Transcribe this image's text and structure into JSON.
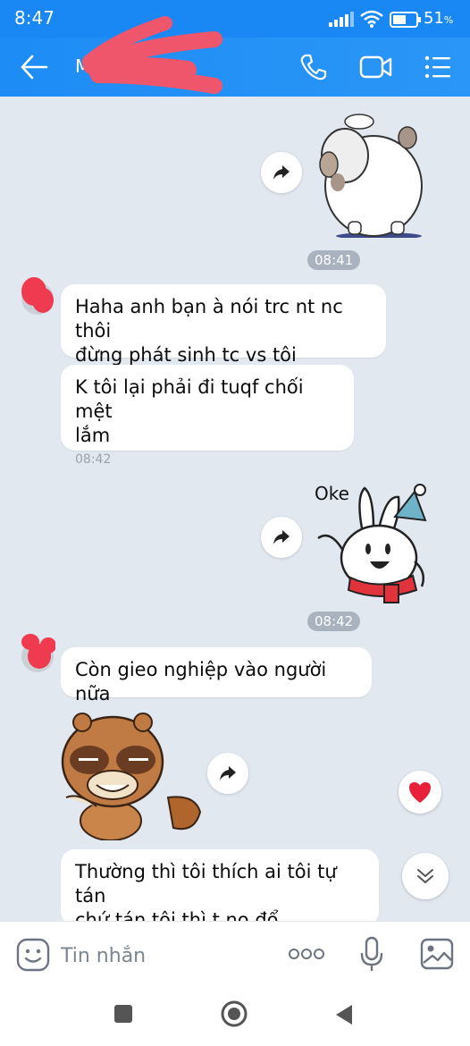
{
  "status": {
    "time": "8:47",
    "battery_value": "51",
    "battery_unit": "%"
  },
  "header": {
    "contact_name_visible": "M                  n"
  },
  "messages": {
    "time1": "08:41",
    "m1_line1": "Haha anh bạn à nói trc nt nc thôi",
    "m1_line2": "đừng phát sinh tc vs tôi",
    "m2_line1": "K tôi lại phải đi tuqf chối mệt",
    "m2_line2": "lắm",
    "m2_time": "08:42",
    "sticker_oke_text": "Oke",
    "time2": "08:42",
    "m3": "Còn gieo nghiệp vào người nữa",
    "m4_line1": "Thường thì tôi thích ai tôi tự tán",
    "m4_line2": "chứ tán tôi thì t no đổ"
  },
  "input": {
    "placeholder": "Tin nhắn"
  },
  "colors": {
    "accent": "#1a88f4",
    "chat_bg": "#e2e8f0",
    "bubble": "#ffffff",
    "heart": "#e8203a"
  },
  "icons": [
    "back-arrow-icon",
    "phone-icon",
    "video-icon",
    "menu-icon",
    "forward-icon",
    "heart-icon",
    "chevron-double-down-icon",
    "emoji-icon",
    "more-dots-icon",
    "mic-icon",
    "image-icon",
    "nav-recents-icon",
    "nav-home-icon",
    "nav-back-icon"
  ]
}
